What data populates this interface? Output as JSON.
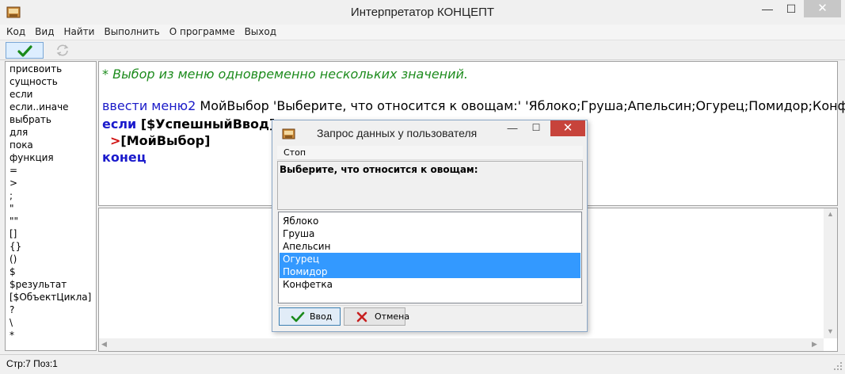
{
  "window": {
    "title": "Интерпретатор КОНЦЕПТ",
    "min_glyph": "—",
    "max_glyph": "☐",
    "close_glyph": "✕"
  },
  "menu": [
    "Код",
    "Вид",
    "Найти",
    "Выполнить",
    "О программе",
    "Выход"
  ],
  "palette": [
    "присвоить",
    "сущность",
    "если",
    "если..иначе",
    "выбрать",
    "для",
    "пока",
    "функция",
    "=",
    ">",
    ";",
    "\"",
    "\"\"",
    "[]",
    "{}",
    "()",
    "$",
    "$результат",
    "[$ОбъектЦикла]",
    "?",
    "\\",
    "*"
  ],
  "editor": {
    "comment": "* Выбор из меню одновременно нескольких значений.",
    "l2_kw": "ввести меню2",
    "l2_rest": " МойВыбор 'Выберите, что относится к овощам:' 'Яблоко;Груша;Апельсин;Огурец;Помидор;Конфетка'",
    "l3_kw": "если",
    "l3_rest": " [$УспешныйВвод]",
    "l4_op": ">",
    "l4_rest": "[МойВыбор]",
    "l5_kw": "конец"
  },
  "dialog": {
    "title": "Запрос данных у пользователя",
    "menu_stop": "Стоп",
    "prompt": "Выберите, что относится к овощам:",
    "options": [
      {
        "label": "Яблоко",
        "selected": false
      },
      {
        "label": "Груша",
        "selected": false
      },
      {
        "label": "Апельсин",
        "selected": false
      },
      {
        "label": "Огурец",
        "selected": true
      },
      {
        "label": "Помидор",
        "selected": true
      },
      {
        "label": "Конфетка",
        "selected": false
      }
    ],
    "btn_enter": "Ввод",
    "btn_cancel": "Отмена",
    "min_glyph": "—",
    "max_glyph": "☐",
    "close_glyph": "✕"
  },
  "status": "Стр:7 Поз:1",
  "colors": {
    "accent": "#3399ff",
    "comment": "#1e8c1e",
    "keyword": "#1a1ac8",
    "operator": "#d01010",
    "close_button": "#c7433b"
  }
}
